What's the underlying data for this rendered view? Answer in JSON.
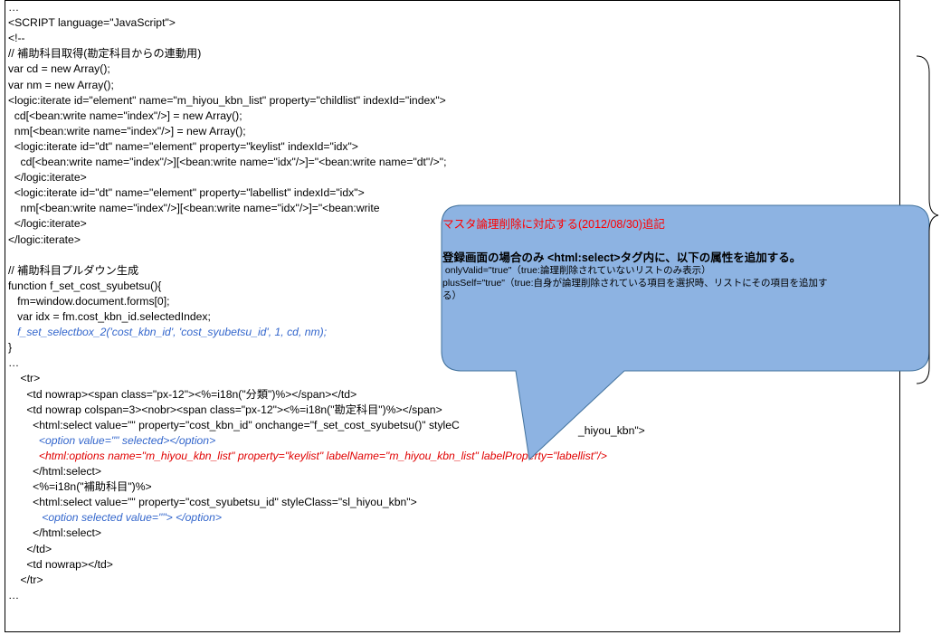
{
  "code_lines": [
    {
      "text": "…",
      "style": "plain"
    },
    {
      "text": "<SCRIPT language=\"JavaScript\">",
      "style": "plain"
    },
    {
      "text": "<!--",
      "style": "plain"
    },
    {
      "text": "// 補助科目取得(勘定科目からの連動用)",
      "style": "plain"
    },
    {
      "text": "var cd = new Array();",
      "style": "plain"
    },
    {
      "text": "var nm = new Array();",
      "style": "plain"
    },
    {
      "text": "<logic:iterate id=\"element\" name=\"m_hiyou_kbn_list\" property=\"childlist\" indexId=\"index\">",
      "style": "plain"
    },
    {
      "text": "  cd[<bean:write name=\"index\"/>] = new Array();",
      "style": "plain"
    },
    {
      "text": "  nm[<bean:write name=\"index\"/>] = new Array();",
      "style": "plain"
    },
    {
      "text": "  <logic:iterate id=\"dt\" name=\"element\" property=\"keylist\" indexId=\"idx\">",
      "style": "plain"
    },
    {
      "text": "    cd[<bean:write name=\"index\"/>][<bean:write name=\"idx\"/>]=\"<bean:write name=\"dt\"/>\";",
      "style": "plain"
    },
    {
      "text": "  </logic:iterate>",
      "style": "plain"
    },
    {
      "text": "  <logic:iterate id=\"dt\" name=\"element\" property=\"labellist\" indexId=\"idx\">",
      "style": "plain"
    },
    {
      "text": "    nm[<bean:write name=\"index\"/>][<bean:write name=\"idx\"/>]=\"<bean:write",
      "style": "plain"
    },
    {
      "text": "  </logic:iterate>",
      "style": "plain"
    },
    {
      "text": "</logic:iterate>",
      "style": "plain"
    },
    {
      "text": "",
      "style": "plain"
    },
    {
      "text": "// 補助科目プルダウン生成",
      "style": "plain"
    },
    {
      "text": "function f_set_cost_syubetsu(){",
      "style": "plain"
    },
    {
      "text": "   fm=window.document.forms[0];",
      "style": "plain"
    },
    {
      "text": "   var idx = fm.cost_kbn_id.selectedIndex;",
      "style": "plain"
    },
    {
      "text": "   f_set_selectbox_2('cost_kbn_id', 'cost_syubetsu_id', 1, cd, nm);",
      "style": "blue"
    },
    {
      "text": "}",
      "style": "plain"
    },
    {
      "text": "…",
      "style": "plain"
    },
    {
      "text": "    <tr>",
      "style": "plain"
    },
    {
      "text": "      <td nowrap><span class=\"px-12\"><%=i18n(\"分類\")%></span></td>",
      "style": "plain"
    },
    {
      "text": "      <td nowrap colspan=3><nobr><span class=\"px-12\"><%=i18n(\"勘定科目\")%></span>",
      "style": "plain"
    },
    {
      "text": "        <html:select value=\"\" property=\"cost_kbn_id\" onchange=\"f_set_cost_syubetsu()\" styleC",
      "style": "plain"
    },
    {
      "text": "          <option value=\"\" selected></option>",
      "style": "blue"
    },
    {
      "text": "          <html:options name=\"m_hiyou_kbn_list\" property=\"keylist\" labelName=\"m_hiyou_kbn_list\" labelProperty=\"labellist\"/>",
      "style": "red"
    },
    {
      "text": "        </html:select>",
      "style": "plain"
    },
    {
      "text": "        <%=i18n(\"補助科目\")%>",
      "style": "plain"
    },
    {
      "text": "        <html:select value=\"\" property=\"cost_syubetsu_id\" styleClass=\"sl_hiyou_kbn\">",
      "style": "plain"
    },
    {
      "text": "           <option selected value=\"\"> </option>",
      "style": "blue"
    },
    {
      "text": "        </html:select>",
      "style": "plain"
    },
    {
      "text": "      </td>",
      "style": "plain"
    },
    {
      "text": "      <td nowrap></td>",
      "style": "plain"
    },
    {
      "text": "    </tr>",
      "style": "plain"
    },
    {
      "text": "…",
      "style": "plain"
    }
  ],
  "hidden_tail": "_hiyou_kbn\">",
  "callout": {
    "title": "マスタ論理削除に対応する(2012/08/30)追記",
    "heading": "登録画面の場合のみ <html:select>タグ内に、以下の属性を追加する。",
    "line1": " onlyValid=\"true\"（true:論理削除されていないリストのみ表示）",
    "line2": "plusSelf=\"true\"（true:自身が論理削除されている項目を選択時、リストにその項目を追加す",
    "line3": "る）"
  },
  "colors": {
    "blue_code": "#3366cc",
    "red_code": "#e00000",
    "callout_fill": "#8db3e2",
    "callout_stroke": "#41719c"
  }
}
